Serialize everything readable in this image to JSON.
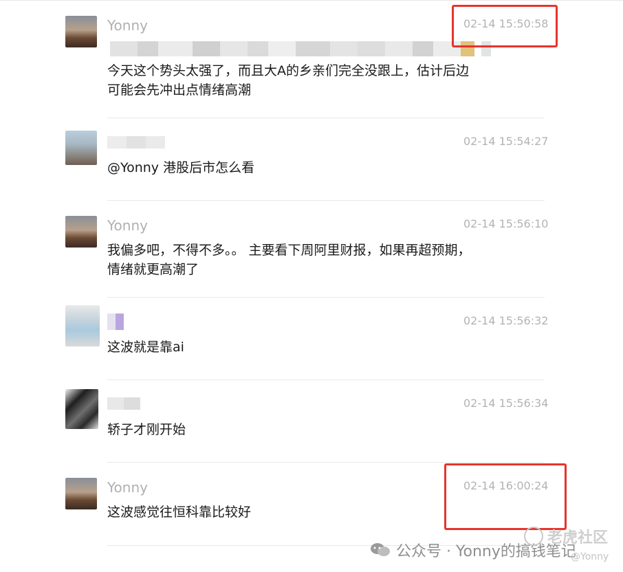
{
  "messages": [
    {
      "name": "Yonny",
      "time": "02-14 15:50:58",
      "text": "今天这个势头太强了，而且大A的乡亲们完全没跟上，估计后边\n可能会先冲出点情绪高潮"
    },
    {
      "name": "",
      "time": "02-14 15:54:27",
      "text": "@Yonny 港股后市怎么看"
    },
    {
      "name": "Yonny",
      "time": "02-14 15:56:10",
      "text": "我偏多吧，不得不多。。 主要看下周阿里财报，如果再超预期，\n情绪就更高潮了"
    },
    {
      "name": "",
      "time": "02-14 15:56:32",
      "text": "这波就是靠ai"
    },
    {
      "name": "",
      "time": "02-14 15:56:34",
      "text": "轿子才刚开始"
    },
    {
      "name": "Yonny",
      "time": "02-14 16:00:24",
      "text": " 这波感觉往恒科靠比较好"
    }
  ],
  "watermark": {
    "wechat": "公众号 · Yonny的搞钱笔记",
    "community": "老虎社区",
    "handle": "@Yonny"
  },
  "colors": {
    "highlight": "#e5342c",
    "time": "#b3b3b3",
    "name": "#b0b0b0"
  }
}
